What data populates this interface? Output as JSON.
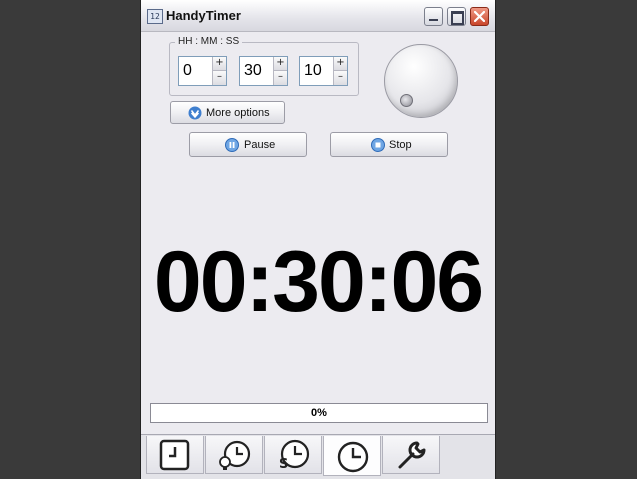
{
  "window": {
    "title": "HandyTimer",
    "app_icon_text": "12"
  },
  "time_input": {
    "legend": "HH : MM : SS",
    "hours": "0",
    "minutes": "30",
    "seconds": "10",
    "up_glyph": "+",
    "down_glyph": "–"
  },
  "buttons": {
    "more_options": "More options",
    "pause": "Pause",
    "stop": "Stop"
  },
  "timer": {
    "display": "00:30:06"
  },
  "progress": {
    "percent_text": "0%",
    "value": 0
  },
  "tabs": [
    {
      "icon": "stopwatch-square-icon",
      "active": false
    },
    {
      "icon": "alarm-bulb-clock-icon",
      "active": false
    },
    {
      "icon": "scheduled-clock-icon",
      "active": false
    },
    {
      "icon": "countdown-clock-icon",
      "active": true
    },
    {
      "icon": "wrench-settings-icon",
      "active": false
    }
  ],
  "colors": {
    "accent": "#3c7fd0",
    "window_bg": "#ecebf0",
    "desktop_bg": "#3a3a3a"
  }
}
